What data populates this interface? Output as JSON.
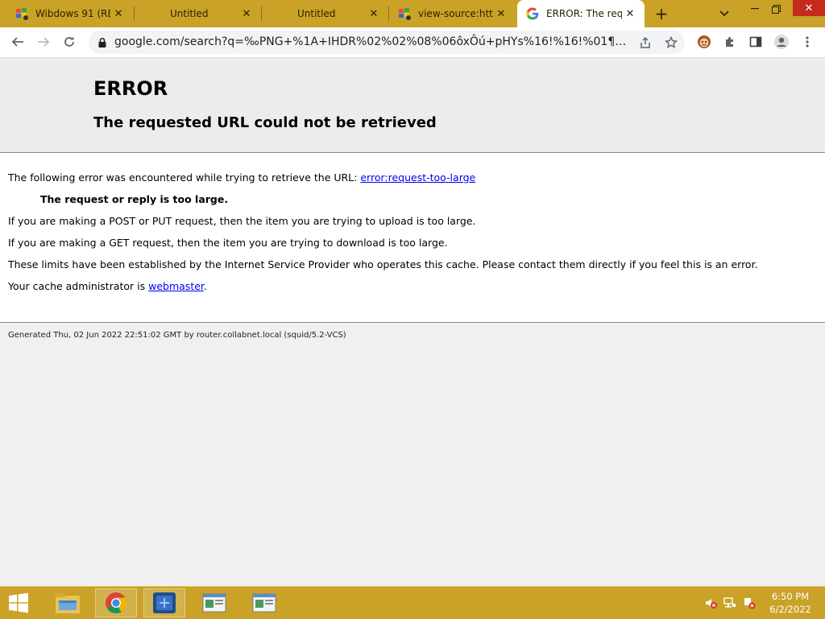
{
  "browser": {
    "tabs": [
      {
        "title": "Wibdows 91 (REL",
        "favicon": "windows-flag-icon",
        "active": false
      },
      {
        "title": "Untitled",
        "favicon": "none",
        "active": false
      },
      {
        "title": "Untitled",
        "favicon": "none",
        "active": false
      },
      {
        "title": "view-source:https:",
        "favicon": "windows-flag-icon",
        "active": false
      },
      {
        "title": "ERROR: The reque",
        "favicon": "google-g-icon",
        "active": true
      }
    ],
    "address_bar": {
      "url": "google.com/search?q=‰PNG+%1A+IHDR%02%02%08%06ôxÔú+pHYs%16!%16!%01¶¯£ã%19tEXtSo..."
    }
  },
  "page": {
    "error_title": "ERROR",
    "error_subtitle": "The requested URL could not be retrieved",
    "line1_text": "The following error was encountered while trying to retrieve the URL: ",
    "line1_link": "error:request-too-large",
    "line2_bold": "The request or reply is too large.",
    "line3": "If you are making a POST or PUT request, then the item you are trying to upload is too large.",
    "line4": "If you are making a GET request, then the item you are trying to download is too large.",
    "line5": "These limits have been established by the Internet Service Provider who operates this cache. Please contact them directly if you feel this is an error.",
    "line6_text": "Your cache administrator is ",
    "line6_link": "webmaster",
    "line6_after": ".",
    "footer": "Generated Thu, 02 Jun 2022 22:51:02 GMT by router.collabnet.local (squid/5.2-VCS)"
  },
  "taskbar": {
    "clock_time": "6:50 PM",
    "clock_date": "6/2/2022",
    "colors": {
      "bar": "#c9a227"
    }
  }
}
